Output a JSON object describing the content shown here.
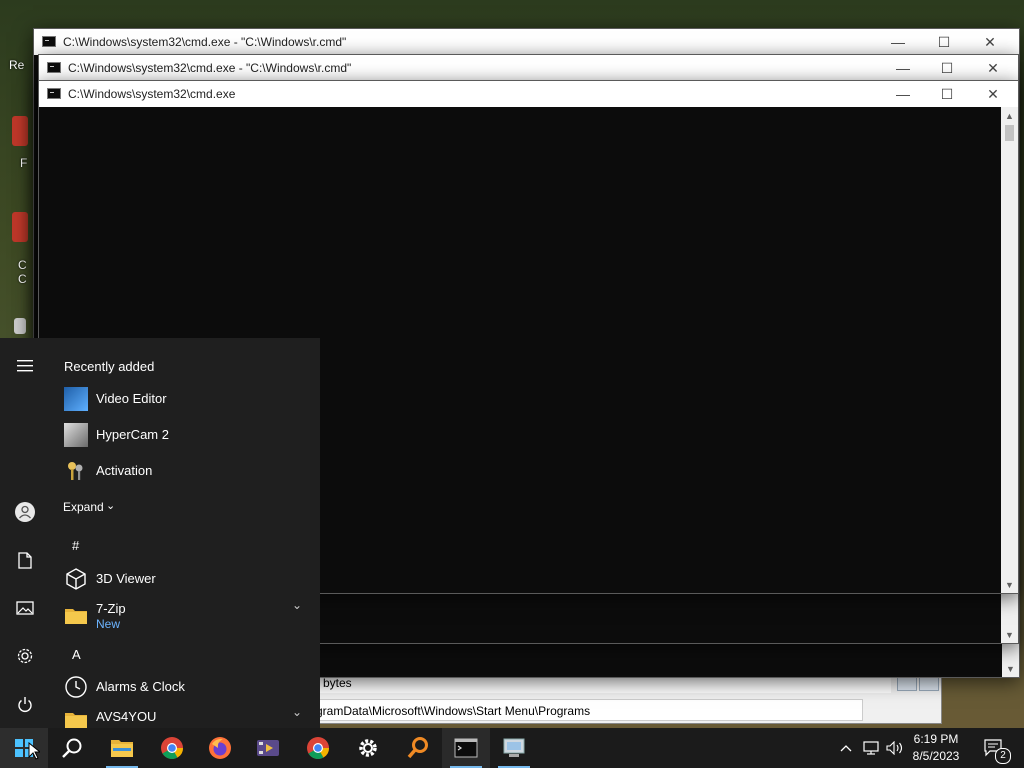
{
  "desktop": {
    "label_partial_1": "Re",
    "label_partial_2": "F",
    "label_partial_3": "C",
    "label_partial_4": "C"
  },
  "explorer": {
    "row1_text": "bytes",
    "address_path": "gramData\\Microsoft\\Windows\\Start Menu\\Programs"
  },
  "cmd_windows": [
    {
      "title": "C:\\Windows\\system32\\cmd.exe - \"C:\\Windows\\r.cmd\""
    },
    {
      "title": "C:\\Windows\\system32\\cmd.exe - \"C:\\Windows\\r.cmd\""
    },
    {
      "title": "C:\\Windows\\system32\\cmd.exe"
    }
  ],
  "window_controls": {
    "minimize": "—",
    "maximize": "☐",
    "close": "✕"
  },
  "scrollbar": {
    "up": "▲",
    "down": "▼"
  },
  "start_menu": {
    "recently_added": "Recently added",
    "recent_apps": [
      {
        "name": "Video Editor"
      },
      {
        "name": "HyperCam 2"
      },
      {
        "name": "Activation"
      }
    ],
    "expand_label": "Expand",
    "section_hash": "#",
    "section_a": "A",
    "apps": [
      {
        "name": "3D Viewer",
        "badge": ""
      },
      {
        "name": "7-Zip",
        "badge": "New"
      },
      {
        "name": "Alarms & Clock",
        "badge": ""
      },
      {
        "name": "AVS4YOU",
        "badge": ""
      }
    ]
  },
  "taskbar": {
    "time": "6:19 PM",
    "date": "8/5/2023",
    "notification_count": "2"
  },
  "colors": {
    "accent": "#76b9ed",
    "start_bg": "#1f1f1f",
    "taskbar_bg": "#1b1b1b",
    "console_bg": "#0c0c0c",
    "new_badge": "#6cb4ff"
  }
}
